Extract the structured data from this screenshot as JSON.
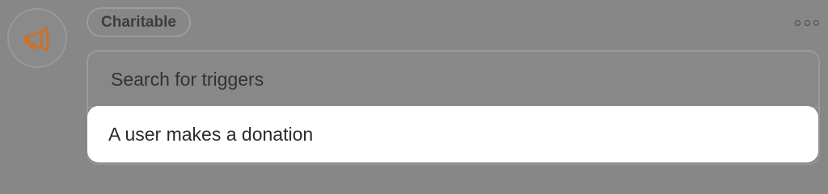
{
  "trigger_card": {
    "icon": "megaphone-icon",
    "icon_color": "#c9722b",
    "category_chip": "Charitable",
    "more_icon": "more-horizontal-icon",
    "search": {
      "placeholder": "Search for triggers",
      "value": ""
    },
    "options": [
      {
        "label": "A user makes a donation"
      }
    ]
  }
}
